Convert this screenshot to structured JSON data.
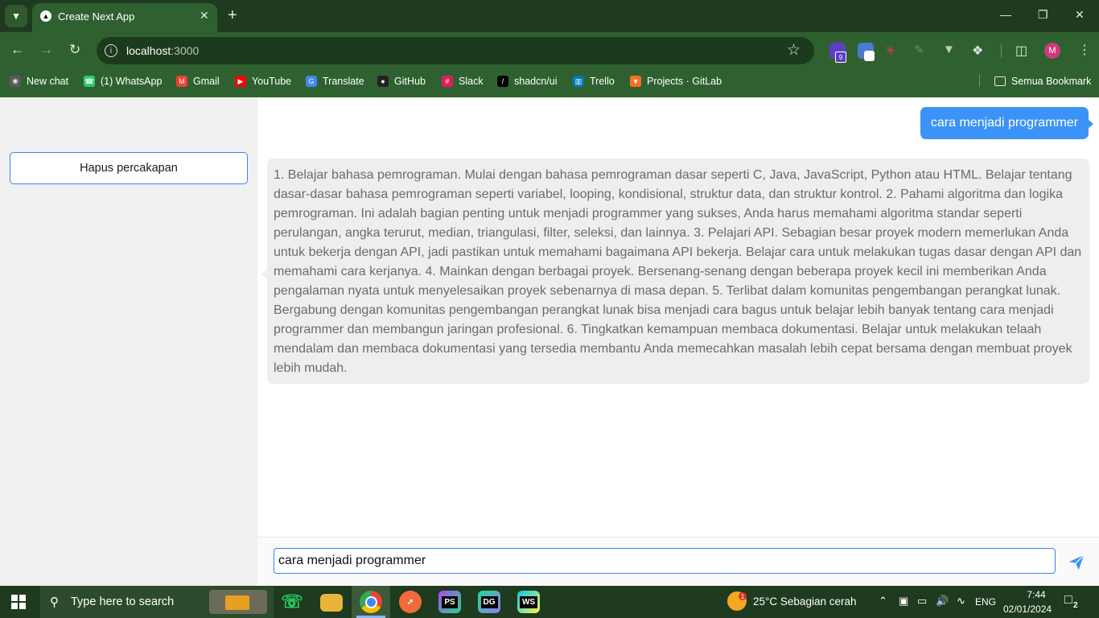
{
  "browser": {
    "tab_title": "Create Next App",
    "url_host": "localhost",
    "url_port": ":3000",
    "profile_initial": "M",
    "extension_badge": "9",
    "bookmarks": [
      {
        "label": "New chat",
        "icon": "openai-icon",
        "color": "#5a5a5a"
      },
      {
        "label": "(1) WhatsApp",
        "icon": "whatsapp-icon",
        "color": "#25d366"
      },
      {
        "label": "Gmail",
        "icon": "gmail-icon",
        "color": "#ea4335"
      },
      {
        "label": "YouTube",
        "icon": "youtube-icon",
        "color": "#ff0000"
      },
      {
        "label": "Translate",
        "icon": "translate-icon",
        "color": "#4285f4"
      },
      {
        "label": "GitHub",
        "icon": "github-icon",
        "color": "#222222"
      },
      {
        "label": "Slack",
        "icon": "slack-icon",
        "color": "#e01e5a"
      },
      {
        "label": "shadcn/ui",
        "icon": "shadcn-icon",
        "color": "#000000"
      },
      {
        "label": "Trello",
        "icon": "trello-icon",
        "color": "#0079bf"
      },
      {
        "label": "Projects · GitLab",
        "icon": "gitlab-icon",
        "color": "#fc6d26"
      }
    ],
    "bookmarks_folder": "Semua Bookmark"
  },
  "sidebar": {
    "clear_button": "Hapus percakapan"
  },
  "chat": {
    "messages": [
      {
        "role": "user",
        "text": "cara menjadi programmer"
      },
      {
        "role": "assistant",
        "text": "1. Belajar bahasa pemrograman. Mulai dengan bahasa pemrograman dasar seperti C, Java, JavaScript, Python atau HTML. Belajar tentang dasar-dasar bahasa pemrograman seperti variabel, looping, kondisional, struktur data, dan struktur kontrol. 2. Pahami algoritma dan logika pemrograman. Ini adalah bagian penting untuk menjadi programmer yang sukses, Anda harus memahami algoritma standar seperti perulangan, angka terurut, median, triangulasi, filter, seleksi, dan lainnya. 3. Pelajari API. Sebagian besar proyek modern memerlukan Anda untuk bekerja dengan API, jadi pastikan untuk memahami bagaimana API bekerja. Belajar cara untuk melakukan tugas dasar dengan API dan memahami cara kerjanya. 4. Mainkan dengan berbagai proyek. Bersenang-senang dengan beberapa proyek kecil ini memberikan Anda pengalaman nyata untuk menyelesaikan proyek sebenarnya di masa depan. 5. Terlibat dalam komunitas pengembangan perangkat lunak. Bergabung dengan komunitas pengembangan perangkat lunak bisa menjadi cara bagus untuk belajar lebih banyak tentang cara menjadi programmer dan membangun jaringan profesional. 6. Tingkatkan kemampuan membaca dokumentasi. Belajar untuk melakukan telaah mendalam dan membaca dokumentasi yang tersedia membantu Anda memecahkan masalah lebih cepat bersama dengan membuat proyek lebih mudah."
      }
    ],
    "input_value": "cara menjadi programmer"
  },
  "taskbar": {
    "search_placeholder": "Type here to search",
    "weather_badge": "1",
    "weather": "25°C  Sebagian cerah",
    "language": "ENG",
    "time": "7:44",
    "date": "02/01/2024",
    "notification_count": "2"
  },
  "colors": {
    "accent": "#3b82f6",
    "user_bubble": "#3b93f7",
    "assistant_bubble": "#eeeeee",
    "chrome_frame": "#2f6130"
  }
}
